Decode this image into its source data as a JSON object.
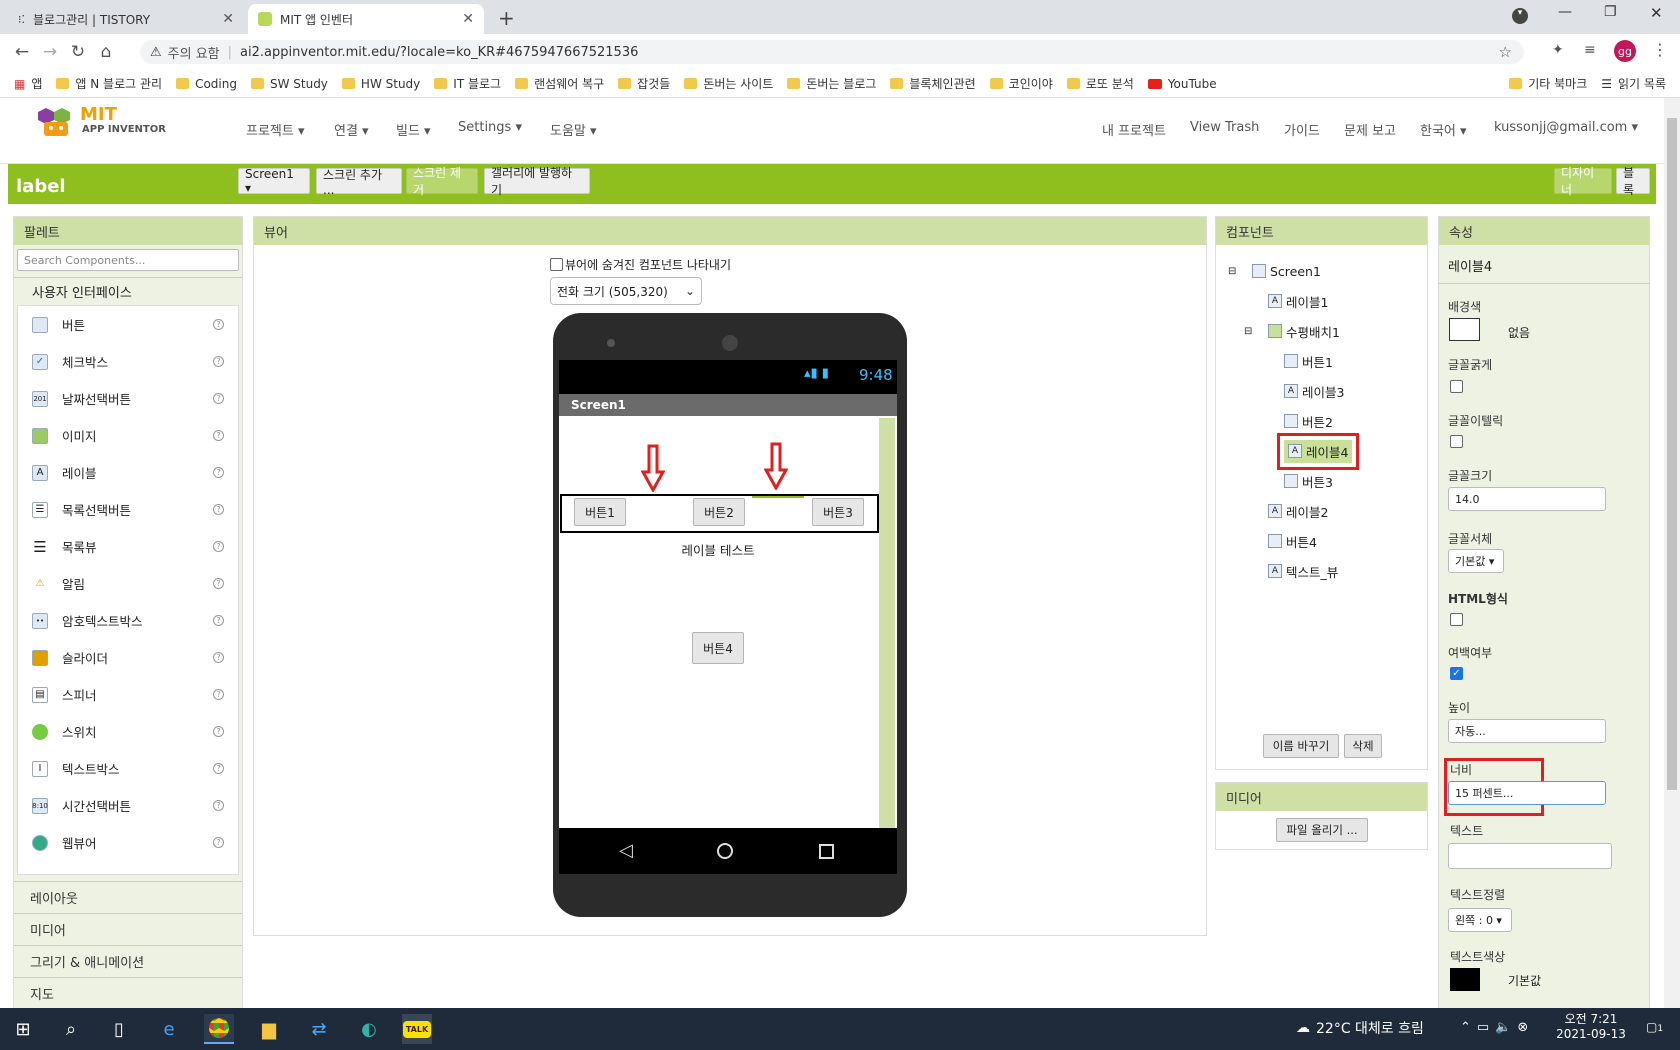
{
  "browser": {
    "tabs": [
      {
        "title": "블로그관리 | TISTORY"
      },
      {
        "title": "MIT 앱 인벤터"
      }
    ],
    "new_tab": "+",
    "address": {
      "warning": "주의 요함",
      "url": "ai2.appinventor.mit.edu/?locale=ko_KR#4675947667521536"
    },
    "profile": "gg",
    "bookmarks": [
      "앱",
      "앱 N 블로그 관리",
      "Coding",
      "SW Study",
      "HW Study",
      "IT 블로그",
      "랜섬웨어 복구",
      "잡것들",
      "돈버는 사이트",
      "돈버는 블로그",
      "블록체인관련",
      "코인이야",
      "로또 분석",
      "YouTube"
    ],
    "bookmarks_right": [
      "기타 북마크",
      "읽기 목록"
    ]
  },
  "app": {
    "logo_top": "MIT",
    "logo_bottom": "APP INVENTOR",
    "menus": [
      "프로젝트 ▾",
      "연결 ▾",
      "빌드 ▾",
      "Settings ▾",
      "도움말 ▾"
    ],
    "right_menus": [
      "내 프로젝트",
      "View Trash",
      "가이드",
      "문제 보고",
      "한국어 ▾",
      "kussonjj@gmail.com ▾"
    ],
    "project_name": "label",
    "toolbar": [
      "Screen1 ▾",
      "스크린 추가 ...",
      "스크린 제거",
      "갤러리에 발행하기"
    ],
    "mode_buttons": [
      "디자이너",
      "블록"
    ]
  },
  "palette": {
    "title": "팔레트",
    "search_placeholder": "Search Components...",
    "category": "사용자 인터페이스",
    "items": [
      "버튼",
      "체크박스",
      "날짜선택버튼",
      "이미지",
      "레이블",
      "목록선택버튼",
      "목록뷰",
      "알림",
      "암호텍스트박스",
      "슬라이더",
      "스피너",
      "스위치",
      "텍스트박스",
      "시간선택버튼",
      "웹뷰어"
    ],
    "other_categories": [
      "레이아웃",
      "미디어",
      "그리기 & 애니메이션",
      "지도"
    ]
  },
  "viewer": {
    "title": "뷰어",
    "show_hidden": "뷰어에 숨겨진 컴포넌트 나타내기",
    "size_select": "전화 크기 (505,320)",
    "phone": {
      "time": "9:48",
      "screen_title": "Screen1",
      "buttons": [
        "버튼1",
        "버튼2",
        "버튼3"
      ],
      "label": "레이블 테스트",
      "button4": "버튼4"
    }
  },
  "components": {
    "title": "컴포넌트",
    "tree": [
      "Screen1",
      "레이블1",
      "수평배치1",
      "버튼1",
      "레이블3",
      "버튼2",
      "레이블4",
      "버튼3",
      "레이블2",
      "버튼4",
      "텍스트_뷰"
    ],
    "rename": "이름 바꾸기",
    "delete": "삭제"
  },
  "media": {
    "title": "미디어",
    "upload": "파일 올리기 ..."
  },
  "properties": {
    "title": "속성",
    "selected": "레이블4",
    "bg_label": "배경색",
    "bg_value": "없음",
    "bold_label": "글꼴굵게",
    "italic_label": "글꼴이텔릭",
    "size_label": "글꼴크기",
    "size_value": "14.0",
    "face_label": "글꼴서체",
    "face_value": "기본값 ▾",
    "html_label": "HTML형식",
    "margin_label": "여백여부",
    "height_label": "높이",
    "height_value": "자동...",
    "width_label": "너비",
    "width_value": "15 퍼센트...",
    "text_label": "텍스트",
    "align_label": "텍스트정렬",
    "align_value": "왼쪽 : 0 ▾",
    "color_label": "텍스트색상",
    "color_value": "기본값"
  },
  "taskbar": {
    "weather": "22°C 대체로 흐림",
    "time": "오전 7:21",
    "date": "2021-09-13",
    "notif": "1"
  },
  "colors": {
    "green": "#8fbf1f",
    "highlight": "#e02020"
  }
}
